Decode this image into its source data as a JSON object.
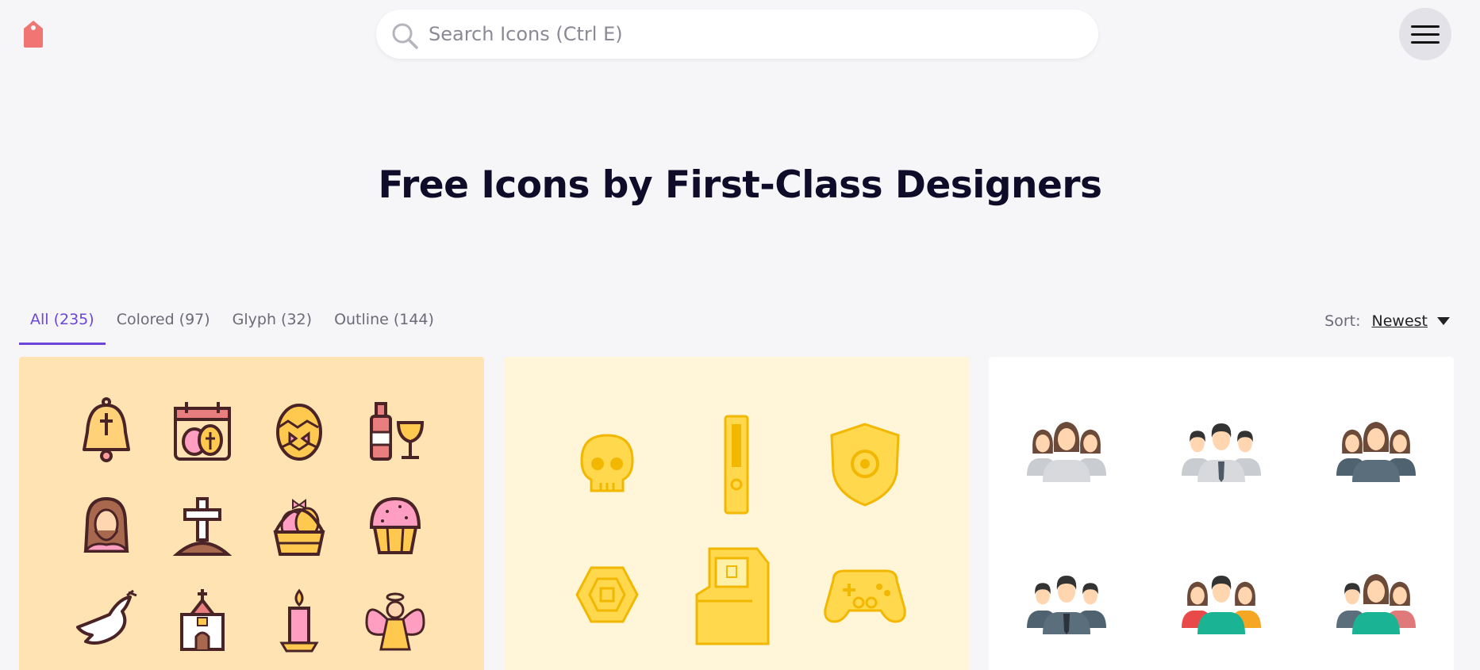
{
  "header": {
    "logo": "tag-icon",
    "search_placeholder": "Search Icons (Ctrl E)",
    "menu_icon": "hamburger-menu-icon"
  },
  "hero": {
    "title": "Free Icons by First-Class Designers"
  },
  "tabs": [
    {
      "label": "All (235)",
      "active": true
    },
    {
      "label": "Colored (97)",
      "active": false
    },
    {
      "label": "Glyph (32)",
      "active": false
    },
    {
      "label": "Outline (144)",
      "active": false
    }
  ],
  "sort": {
    "label": "Sort:",
    "value": "Newest"
  },
  "cards": [
    {
      "theme": "easter",
      "background": "#ffe3b3",
      "icons": [
        "bell-icon",
        "easter-calendar-icon",
        "easter-egg-icon",
        "wine-chalice-icon",
        "jesus-icon",
        "grave-cross-icon",
        "egg-basket-icon",
        "cupcake-icon",
        "dove-icon",
        "church-icon",
        "candle-icon",
        "angel-icon"
      ]
    },
    {
      "theme": "gaming",
      "background": "#fff6d9",
      "icons": [
        "skull-icon",
        "game-console-icon",
        "shield-icon",
        "coin-icon",
        "arcade-machine-icon",
        "gamepad-icon"
      ]
    },
    {
      "theme": "team",
      "background": "#ffffff",
      "icons": [
        "women-team-icon",
        "men-team-icon",
        "dark-women-team-icon",
        "dark-men-team-icon",
        "colored-team-icon",
        "colored-team-women-icon"
      ]
    }
  ],
  "colors": {
    "accent": "#6b46d9",
    "logo": "#f07673",
    "title": "#0f0c29"
  }
}
